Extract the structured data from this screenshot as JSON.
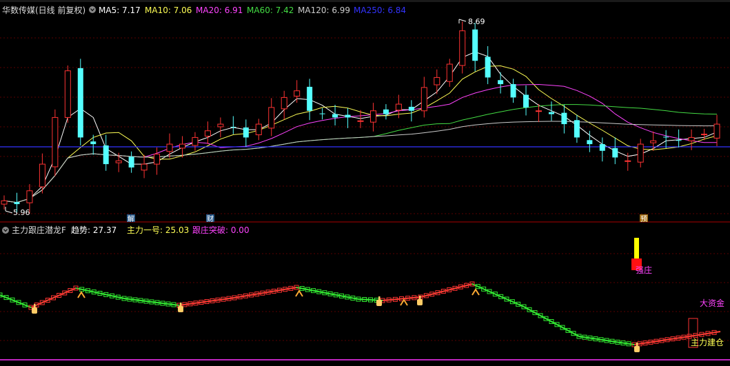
{
  "top_panel": {
    "title": "华数传媒(日线 前复权)",
    "ma_labels": [
      {
        "text": "MA5: 7.17",
        "color": "#ffffff"
      },
      {
        "text": "MA10: 7.06",
        "color": "#ffff55"
      },
      {
        "text": "MA20: 6.91",
        "color": "#ff44ff"
      },
      {
        "text": "MA60: 7.42",
        "color": "#44dd44"
      },
      {
        "text": "MA120: 6.99",
        "color": "#cccccc"
      },
      {
        "text": "MA250: 6.84",
        "color": "#3333ff"
      }
    ],
    "high_label": "8.69",
    "low_label": "5.96",
    "event_markers": [
      "解",
      "财",
      "预"
    ]
  },
  "bottom_panel": {
    "title": "主力跟庄潜龙F",
    "indicator_values": [
      {
        "text": "趋势: 27.37",
        "color": "#ffffff"
      },
      {
        "text": "主力一号: 25.03",
        "color": "#ffff55"
      },
      {
        "text": "跟庄突破: 0.00",
        "color": "#ff44ff"
      }
    ],
    "signal_labels": {
      "strong": "强庄",
      "big_money": "大资金",
      "build": "主力建仓"
    }
  },
  "colors": {
    "background": "#000000",
    "up": "#ff3333",
    "down": "#55ffff",
    "grid": "#5a0000",
    "separator": "#aa0000"
  },
  "chart_data": {
    "type": "candlestick",
    "price_range": [
      5.96,
      8.69
    ],
    "close_path": [
      6.05,
      6.0,
      6.2,
      6.6,
      7.3,
      8.0,
      7.0,
      6.9,
      6.6,
      6.65,
      6.55,
      6.6,
      6.75,
      6.9,
      6.9,
      7.0,
      7.1,
      7.2,
      7.15,
      7.0,
      7.2,
      7.45,
      7.6,
      7.7,
      7.4,
      7.35,
      7.3,
      7.3,
      7.25,
      7.4,
      7.35,
      7.5,
      7.4,
      7.75,
      7.9,
      8.1,
      8.6,
      8.15,
      7.9,
      7.8,
      7.6,
      7.45,
      7.4,
      7.35,
      7.2,
      7.0,
      6.9,
      6.8,
      6.7,
      6.65,
      6.9,
      6.95,
      7.0,
      6.95,
      7.0,
      7.05,
      7.2
    ]
  }
}
